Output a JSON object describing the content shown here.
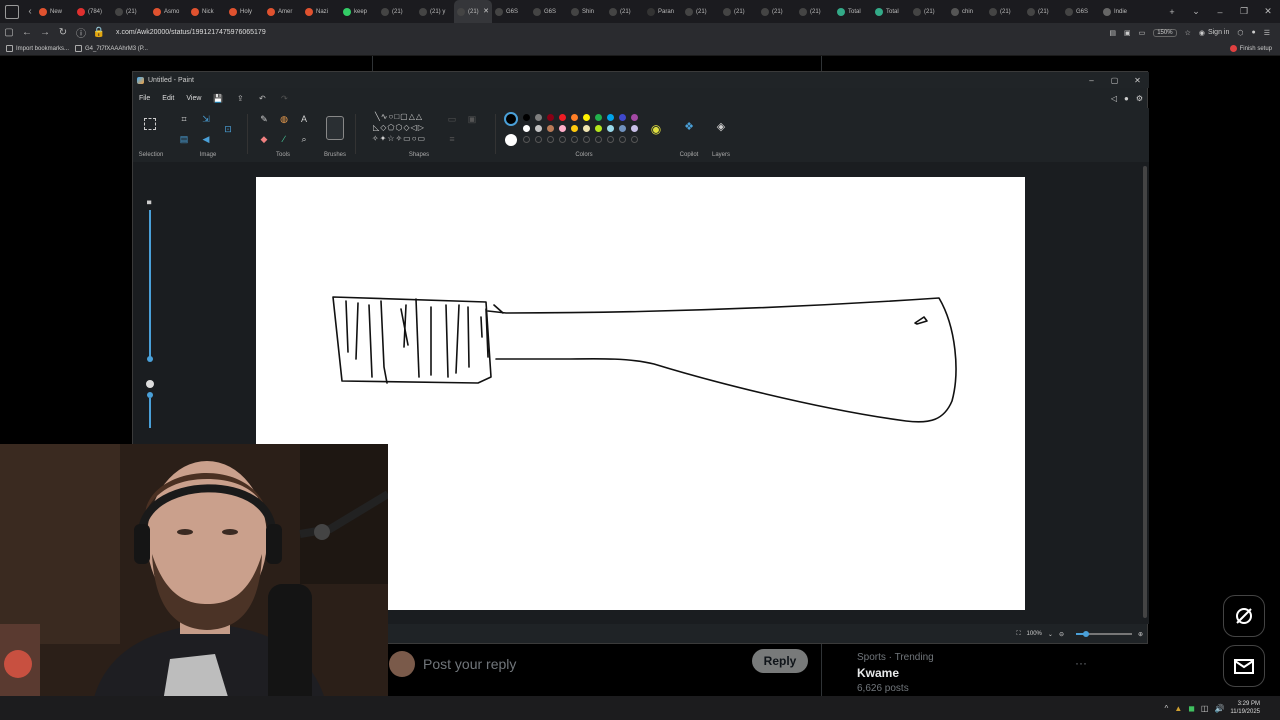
{
  "browser": {
    "tabs": [
      {
        "label": "New",
        "color": "#e0522f"
      },
      {
        "label": "(784)",
        "color": "#e0302f"
      },
      {
        "label": "(21)",
        "color": "#444444"
      },
      {
        "label": "Asmo",
        "color": "#e0522f"
      },
      {
        "label": "Nick",
        "color": "#e0522f"
      },
      {
        "label": "Holy",
        "color": "#e0522f"
      },
      {
        "label": "Amer",
        "color": "#e0522f"
      },
      {
        "label": "Nazi",
        "color": "#e0522f"
      },
      {
        "label": "keep",
        "color": "#3c6"
      },
      {
        "label": "(21)",
        "color": "#444444"
      },
      {
        "label": "(21) y",
        "color": "#444444"
      },
      {
        "label": "(21)",
        "color": "#444444",
        "active": true
      },
      {
        "label": "G6S",
        "color": "#444444"
      },
      {
        "label": "G6S",
        "color": "#444444"
      },
      {
        "label": "Shin",
        "color": "#444444"
      },
      {
        "label": "(21)",
        "color": "#444444"
      },
      {
        "label": "Paran",
        "color": "#333333"
      },
      {
        "label": "(21)",
        "color": "#444444"
      },
      {
        "label": "(21)",
        "color": "#444444"
      },
      {
        "label": "(21)",
        "color": "#444444"
      },
      {
        "label": "(21)",
        "color": "#444444"
      },
      {
        "label": "Total",
        "color": "#3a8"
      },
      {
        "label": "Total",
        "color": "#3a8"
      },
      {
        "label": "(21)",
        "color": "#444444"
      },
      {
        "label": "chin",
        "color": "#555555"
      },
      {
        "label": "(21)",
        "color": "#444444"
      },
      {
        "label": "(21)",
        "color": "#444444"
      },
      {
        "label": "G6S",
        "color": "#444444"
      },
      {
        "label": "Indie",
        "color": "#666666"
      }
    ],
    "url": "x.com/Awk20000/status/1991217475976065179",
    "zoom": "150%",
    "signin": "Sign in",
    "bookmarks": [
      {
        "label": "Import bookmarks..."
      },
      {
        "label": "G4_7t7fXAAAhrM3 (P..."
      }
    ],
    "finish_setup": "Finish setup"
  },
  "x_page": {
    "reply_placeholder": "Post your reply",
    "reply_button": "Reply",
    "trend_category": "Sports · Trending",
    "trend_name": "Kwame",
    "trend_count": "6,626 posts"
  },
  "paint": {
    "title": "Untitled - Paint",
    "menu": [
      "File",
      "Edit",
      "View"
    ],
    "groups": {
      "selection": "Selection",
      "image": "Image",
      "tools": "Tools",
      "brushes": "Brushes",
      "shapes": "Shapes",
      "colors": "Colors",
      "copilot": "Copilot",
      "layers": "Layers"
    },
    "palette_row1": [
      "#000000",
      "#7f7f7f",
      "#880015",
      "#ed1c24",
      "#ff7f27",
      "#fff200",
      "#22b14c",
      "#00a2e8",
      "#3f48cc",
      "#a349a4"
    ],
    "palette_row2": [
      "#ffffff",
      "#c3c3c3",
      "#b97a57",
      "#ffaec9",
      "#ffc90e",
      "#efe4b0",
      "#b5e61d",
      "#99d9ea",
      "#7092be",
      "#c8bfe7"
    ],
    "zoom_level": "100%"
  },
  "taskbar": {
    "time": "3:29 PM",
    "date": "11/19/2025"
  }
}
